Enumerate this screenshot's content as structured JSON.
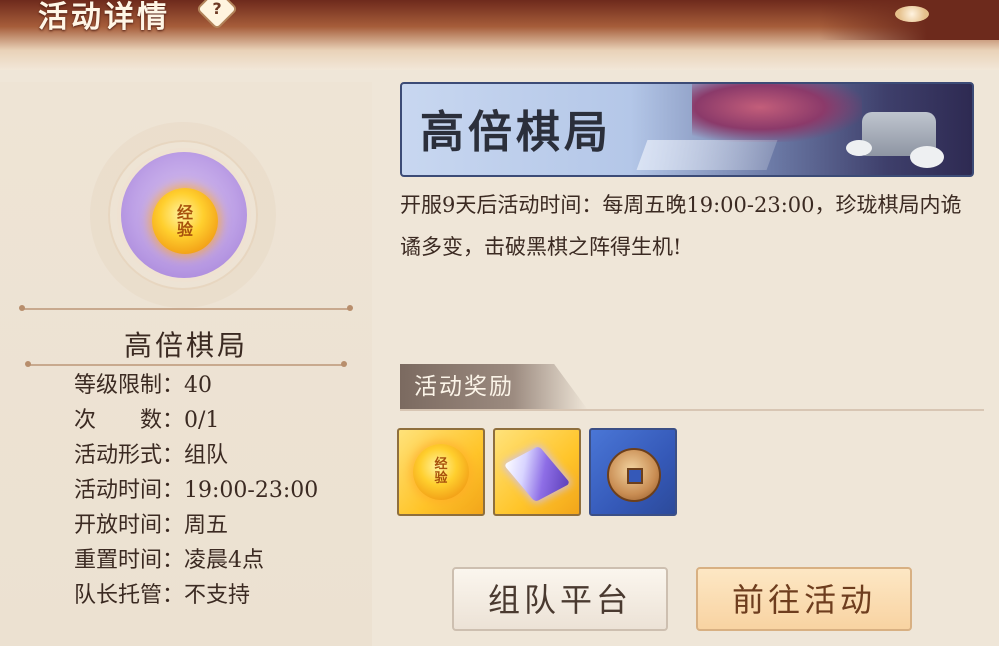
{
  "header": {
    "title": "活动详情",
    "help_label": "?"
  },
  "left": {
    "emblem_text": [
      "经",
      "验"
    ],
    "activity_name": "高倍棋局",
    "info": [
      "等级限制：40",
      "次　　数：0/1",
      "活动形式：组队",
      "活动时间：19:00-23:00",
      "开放时间：周五",
      "重置时间：凌晨4点",
      "队长托管：不支持"
    ]
  },
  "banner": {
    "title": "高倍棋局"
  },
  "description": "开服9天后活动时间：每周五晚19:00-23:00，珍珑棋局内诡谲多变，击破黑棋之阵得生机!",
  "rewards": {
    "title": "活动奖励",
    "items": [
      {
        "icon": "exp-coin-icon",
        "text": [
          "经",
          "验"
        ]
      },
      {
        "icon": "crystal-icon"
      },
      {
        "icon": "copper-coin-icon"
      }
    ]
  },
  "buttons": {
    "team_platform": "组队平台",
    "go_activity": "前往活动"
  },
  "colors": {
    "gold": "#ffc52a",
    "blue_slot": "#3559b8",
    "text": "#3b2a22"
  }
}
